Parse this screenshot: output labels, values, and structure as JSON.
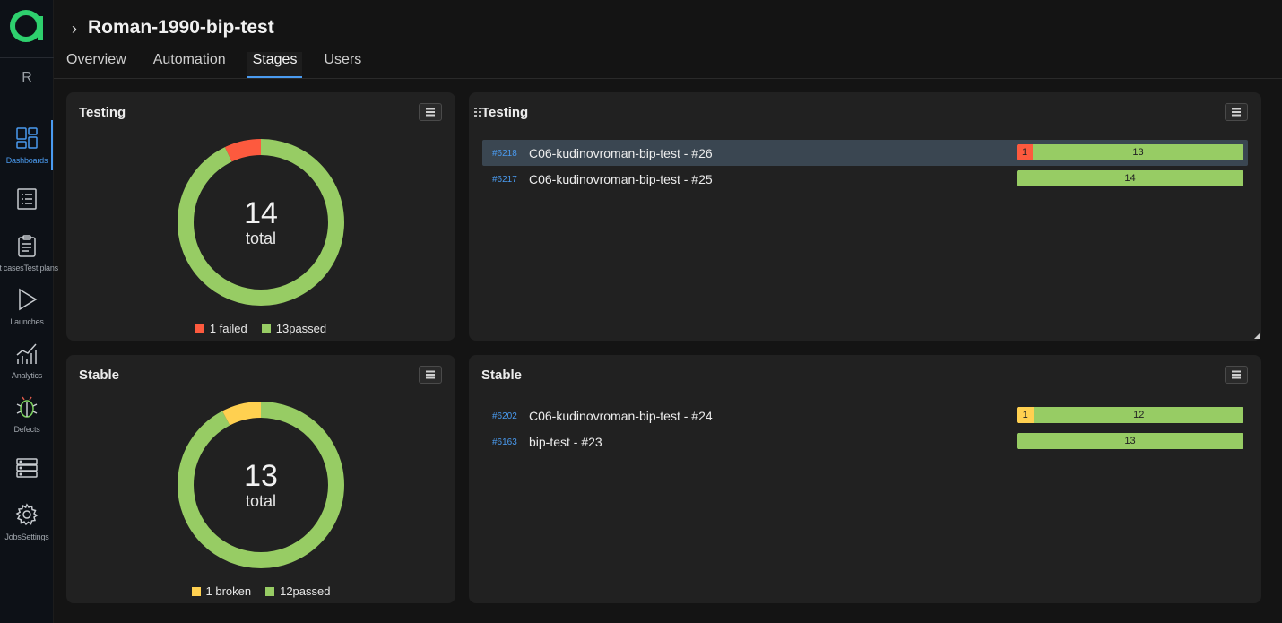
{
  "colors": {
    "passed": "#97cc64",
    "failed": "#fd5a3e",
    "broken": "#ffd050",
    "accent": "#4a9bf0"
  },
  "sidebar": {
    "user_initial": "R",
    "items": [
      {
        "label": "Dashboards",
        "icon": "dashboards-icon",
        "active": true
      },
      {
        "label": "",
        "icon": "list-icon"
      },
      {
        "label": "st casesTest plans",
        "icon": "clipboard-icon"
      },
      {
        "label": "Launches",
        "icon": "play-icon"
      },
      {
        "label": "Analytics",
        "icon": "analytics-icon"
      },
      {
        "label": "Defects",
        "icon": "bug-icon"
      },
      {
        "label": "",
        "icon": "server-icon"
      },
      {
        "label": "JobsSettings",
        "icon": "gear-icon"
      }
    ]
  },
  "header": {
    "title": "Roman-1990-bip-test",
    "tabs": [
      "Overview",
      "Automation",
      "Stages",
      "Users"
    ],
    "active_tab": "Stages"
  },
  "widgets": {
    "testing_donut": {
      "title": "Testing",
      "total": "14",
      "total_label": "total",
      "segments": [
        {
          "label": "failed",
          "value": 1
        },
        {
          "label": "passed",
          "value": 13
        }
      ],
      "legend": [
        {
          "text": "1 failed",
          "status": "failed"
        },
        {
          "text": "13passed",
          "status": "passed"
        }
      ]
    },
    "testing_list": {
      "title": "Testing",
      "rows": [
        {
          "id": "#6218",
          "name": "C06-kudinovroman-bip-test - #26",
          "selected": true,
          "segments": [
            {
              "status": "failed",
              "value": 1
            },
            {
              "status": "passed",
              "value": 13
            }
          ]
        },
        {
          "id": "#6217",
          "name": "C06-kudinovroman-bip-test - #25",
          "selected": false,
          "segments": [
            {
              "status": "passed",
              "value": 14
            }
          ]
        }
      ]
    },
    "stable_donut": {
      "title": "Stable",
      "total": "13",
      "total_label": "total",
      "segments": [
        {
          "label": "broken",
          "value": 1
        },
        {
          "label": "passed",
          "value": 12
        }
      ],
      "legend": [
        {
          "text": "1 broken",
          "status": "broken"
        },
        {
          "text": "12passed",
          "status": "passed"
        }
      ]
    },
    "stable_list": {
      "title": "Stable",
      "rows": [
        {
          "id": "#6202",
          "name": "C06-kudinovroman-bip-test - #24",
          "selected": false,
          "segments": [
            {
              "status": "broken",
              "value": 1
            },
            {
              "status": "passed",
              "value": 12
            }
          ]
        },
        {
          "id": "#6163",
          "name": "bip-test - #23",
          "selected": false,
          "segments": [
            {
              "status": "passed",
              "value": 13
            }
          ]
        }
      ]
    }
  }
}
